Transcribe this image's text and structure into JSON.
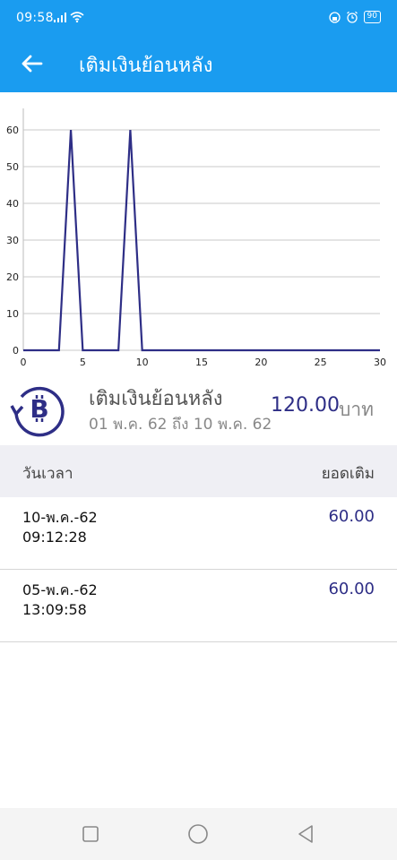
{
  "status_bar": {
    "time": "09:58",
    "battery": "90"
  },
  "app_bar": {
    "title": "เติมเงินย้อนหลัง"
  },
  "chart_data": {
    "type": "line",
    "x": [
      0,
      1,
      2,
      3,
      4,
      5,
      6,
      7,
      8,
      9,
      10,
      11,
      12,
      13,
      14,
      15,
      16,
      17,
      18,
      19,
      20,
      21,
      22,
      23,
      24,
      25,
      26,
      27,
      28,
      29,
      30
    ],
    "series": [
      {
        "values": [
          0,
          0,
          0,
          0,
          60,
          0,
          0,
          0,
          0,
          60,
          0,
          0,
          0,
          0,
          0,
          0,
          0,
          0,
          0,
          0,
          0,
          0,
          0,
          0,
          0,
          0,
          0,
          0,
          0,
          0,
          0
        ]
      }
    ],
    "xlim": [
      0,
      30
    ],
    "ylim": [
      0,
      60
    ],
    "xticks": [
      0,
      5,
      10,
      15,
      20,
      25,
      30
    ],
    "yticks": [
      0,
      10,
      20,
      30,
      40,
      50,
      60
    ],
    "grid": "horizontal",
    "line_color": "#2e2e86",
    "title": "",
    "xlabel": "",
    "ylabel": ""
  },
  "summary": {
    "icon": "bitcoin-history-icon",
    "title": "เติมเงินย้อนหลัง",
    "range": "01 พ.ค. 62 ถึง 10 พ.ค. 62",
    "amount": "120.00",
    "unit": "บาท"
  },
  "table": {
    "header_left": "วันเวลา",
    "header_right": "ยอดเติม",
    "rows": [
      {
        "date": "10-พ.ค.-62",
        "time": "09:12:28",
        "amount": "60.00"
      },
      {
        "date": "05-พ.ค.-62",
        "time": "13:09:58",
        "amount": "60.00"
      }
    ]
  },
  "nav": {
    "icons": [
      "square-icon",
      "circle-icon",
      "triangle-back-icon"
    ]
  },
  "colors": {
    "primary": "#1a9cf0",
    "accent": "#2e2e86"
  }
}
